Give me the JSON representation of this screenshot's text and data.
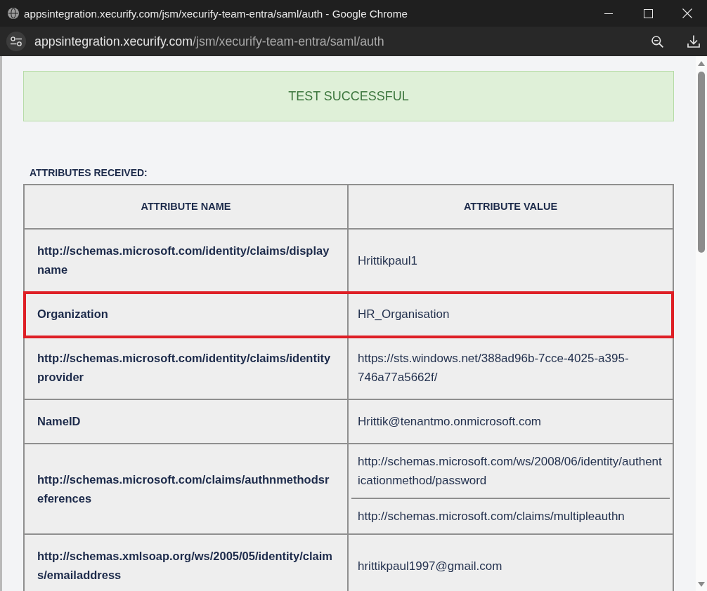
{
  "window": {
    "title": "appsintegration.xecurify.com/jsm/xecurify-team-entra/saml/auth - Google Chrome"
  },
  "address_bar": {
    "host": "appsintegration.xecurify.com",
    "path": "/jsm/xecurify-team-entra/saml/auth"
  },
  "banner": {
    "message": "TEST SUCCESSFUL"
  },
  "section_title": "ATTRIBUTES RECEIVED:",
  "table": {
    "columns": [
      "ATTRIBUTE NAME",
      "ATTRIBUTE VALUE"
    ],
    "rows": [
      {
        "name": "http://schemas.microsoft.com/identity/claims/displayname",
        "values": [
          "Hrittikpaul1"
        ],
        "highlighted": false
      },
      {
        "name": "Organization",
        "values": [
          "HR_Organisation"
        ],
        "highlighted": true
      },
      {
        "name": "http://schemas.microsoft.com/identity/claims/identityprovider",
        "values": [
          "https://sts.windows.net/388ad96b-7cce-4025-a395-746a77a5662f/"
        ],
        "highlighted": false
      },
      {
        "name": "NameID",
        "values": [
          "Hrittik@tenantmo.onmicrosoft.com"
        ],
        "highlighted": false
      },
      {
        "name": "http://schemas.microsoft.com/claims/authnmethodsreferences",
        "values": [
          "http://schemas.microsoft.com/ws/2008/06/identity/authenticationmethod/password",
          "http://schemas.microsoft.com/claims/multipleauthn"
        ],
        "highlighted": false
      },
      {
        "name": "http://schemas.xmlsoap.org/ws/2005/05/identity/claims/emailaddress",
        "values": [
          "hrittikpaul1997@gmail.com"
        ],
        "highlighted": false
      }
    ]
  }
}
